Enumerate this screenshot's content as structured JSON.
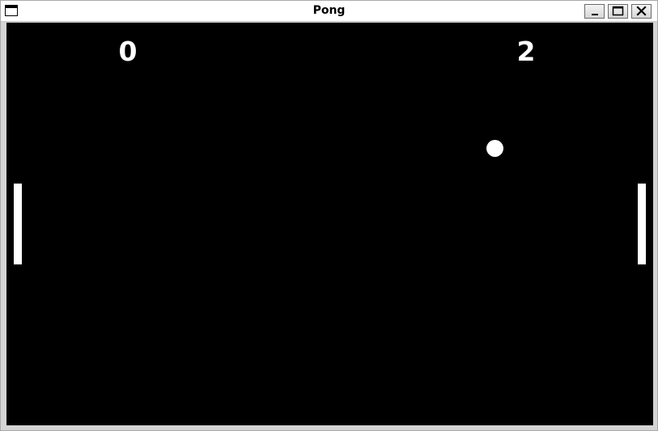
{
  "window": {
    "title": "Pong",
    "controls": {
      "minimize": "minimize-icon",
      "maximize": "maximize-icon",
      "close": "close-icon"
    }
  },
  "game": {
    "background_color": "#000000",
    "foreground_color": "#ffffff",
    "scores": {
      "left": "0",
      "right": "2"
    }
  }
}
